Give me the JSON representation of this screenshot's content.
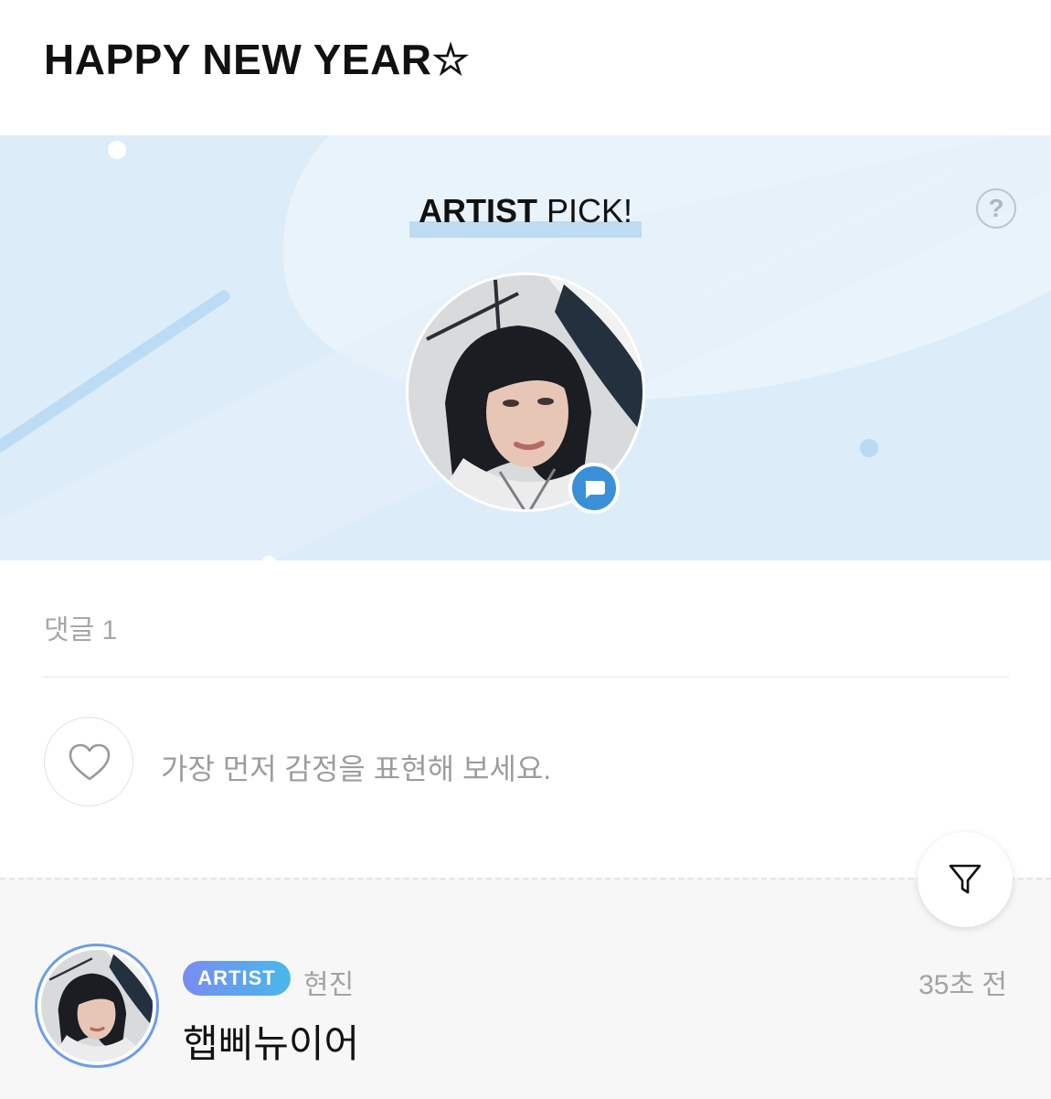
{
  "post": {
    "title": "HAPPY NEW YEAR☆"
  },
  "banner": {
    "pick_strong": "ARTIST",
    "pick_rest": " PICK!",
    "help_label": "?",
    "background_color": "#dcecf9",
    "badge_icon": "chat-bubble-icon"
  },
  "comments_header": {
    "count_label": "댓글 1"
  },
  "reaction": {
    "icon": "heart-outline-icon",
    "prompt": "가장 먼저 감정을 표현해 보세요."
  },
  "filter": {
    "icon": "filter-funnel-icon"
  },
  "comment": {
    "badge": "ARTIST",
    "author": "현진",
    "time": "35초 전",
    "text": "햅삐뉴이어",
    "badge_gradient": [
      "#7a8cf0",
      "#48b8ea"
    ]
  }
}
